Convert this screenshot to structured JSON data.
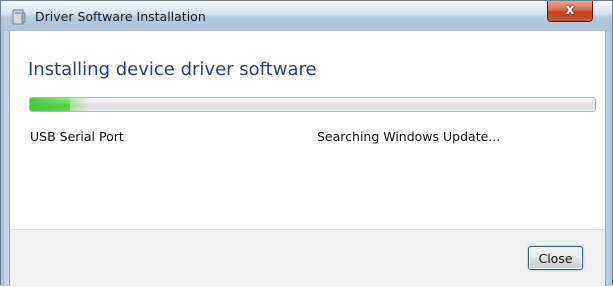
{
  "window": {
    "title": "Driver Software Installation",
    "close_glyph": "x",
    "app_icon": "driver-install-icon"
  },
  "main": {
    "heading": "Installing device driver software",
    "progress_fraction": 0.07,
    "device_name": "USB Serial Port",
    "status": "Searching Windows Update..."
  },
  "footer": {
    "close_label": "Close"
  },
  "colors": {
    "heading": "#1f3f8d",
    "progress_fill": "#2fb51f",
    "titlebar": "#c9dced"
  }
}
